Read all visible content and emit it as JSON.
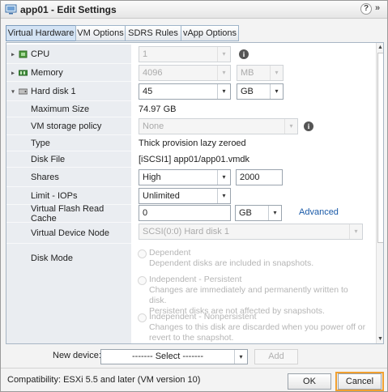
{
  "window": {
    "title": "app01 - Edit Settings",
    "help_glyph": "?",
    "expand_glyph": "»"
  },
  "tabs": [
    {
      "label": "Virtual Hardware",
      "active": true
    },
    {
      "label": "VM Options",
      "active": false
    },
    {
      "label": "SDRS Rules",
      "active": false
    },
    {
      "label": "vApp Options",
      "active": false
    }
  ],
  "hardware": {
    "cpu": {
      "label": "CPU",
      "value": "1"
    },
    "memory": {
      "label": "Memory",
      "value": "4096",
      "unit": "MB"
    },
    "hard_disk": {
      "label": "Hard disk 1",
      "value": "45",
      "unit": "GB"
    },
    "maximum_size": {
      "label": "Maximum Size",
      "value": "74.97 GB"
    },
    "storage_policy": {
      "label": "VM storage policy",
      "value": "None"
    },
    "type": {
      "label": "Type",
      "value": "Thick provision lazy zeroed"
    },
    "disk_file": {
      "label": "Disk File",
      "value": "[iSCSI1] app01/app01.vmdk"
    },
    "shares": {
      "label": "Shares",
      "value": "High",
      "number": "2000"
    },
    "limit_iops": {
      "label": "Limit - IOPs",
      "value": "Unlimited"
    },
    "flash_cache": {
      "label": "Virtual Flash Read Cache",
      "value": "0",
      "unit": "GB",
      "link": "Advanced"
    },
    "device_node": {
      "label": "Virtual Device Node",
      "value": "SCSI(0:0) Hard disk 1"
    },
    "disk_mode": {
      "label": "Disk Mode",
      "options": [
        {
          "title": "Dependent",
          "line1": "Dependent disks are included in snapshots.",
          "line2": ""
        },
        {
          "title": "Independent - Persistent",
          "line1": "Changes are immediately and permanently written to disk.",
          "line2": "Persistent disks are not affected by snapshots."
        },
        {
          "title": "Independent - Nonpersistent",
          "line1": "Changes to this disk are discarded when you power off or",
          "line2": "revert to the snapshot."
        }
      ]
    }
  },
  "new_device": {
    "label": "New device:",
    "select_value": "------- Select -------",
    "add_label": "Add"
  },
  "footer": {
    "compatibility": "Compatibility: ESXi 5.5 and later (VM version 10)",
    "ok_label": "OK",
    "cancel_label": "Cancel"
  },
  "colors": {
    "highlight": "#f0a030",
    "link": "#1a5aa8",
    "tab_active": "#d3e3f4"
  },
  "icons": {
    "info": "i",
    "dropdown": "▾",
    "expanded": "▾",
    "collapsed": "▸"
  }
}
